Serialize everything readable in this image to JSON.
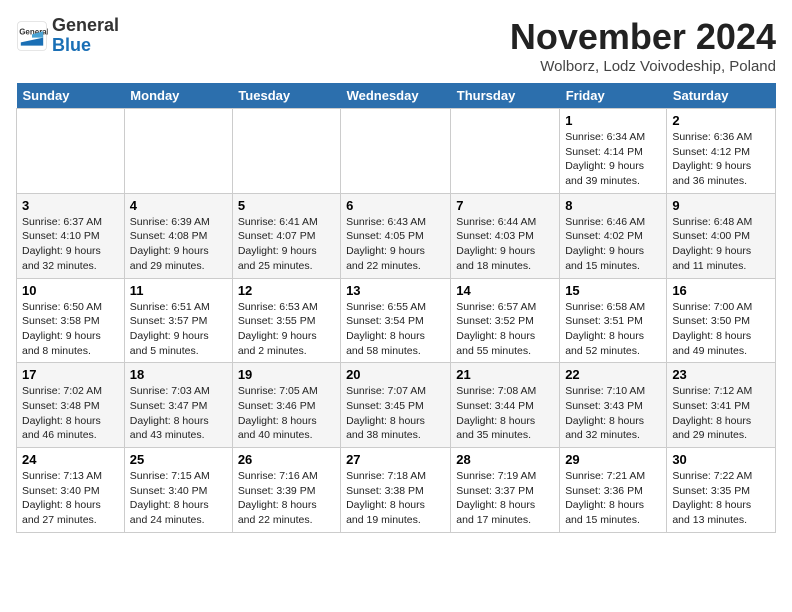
{
  "header": {
    "logo_general": "General",
    "logo_blue": "Blue",
    "month_title": "November 2024",
    "location": "Wolborz, Lodz Voivodeship, Poland"
  },
  "weekdays": [
    "Sunday",
    "Monday",
    "Tuesday",
    "Wednesday",
    "Thursday",
    "Friday",
    "Saturday"
  ],
  "weeks": [
    [
      {
        "day": "",
        "info": ""
      },
      {
        "day": "",
        "info": ""
      },
      {
        "day": "",
        "info": ""
      },
      {
        "day": "",
        "info": ""
      },
      {
        "day": "",
        "info": ""
      },
      {
        "day": "1",
        "info": "Sunrise: 6:34 AM\nSunset: 4:14 PM\nDaylight: 9 hours\nand 39 minutes."
      },
      {
        "day": "2",
        "info": "Sunrise: 6:36 AM\nSunset: 4:12 PM\nDaylight: 9 hours\nand 36 minutes."
      }
    ],
    [
      {
        "day": "3",
        "info": "Sunrise: 6:37 AM\nSunset: 4:10 PM\nDaylight: 9 hours\nand 32 minutes."
      },
      {
        "day": "4",
        "info": "Sunrise: 6:39 AM\nSunset: 4:08 PM\nDaylight: 9 hours\nand 29 minutes."
      },
      {
        "day": "5",
        "info": "Sunrise: 6:41 AM\nSunset: 4:07 PM\nDaylight: 9 hours\nand 25 minutes."
      },
      {
        "day": "6",
        "info": "Sunrise: 6:43 AM\nSunset: 4:05 PM\nDaylight: 9 hours\nand 22 minutes."
      },
      {
        "day": "7",
        "info": "Sunrise: 6:44 AM\nSunset: 4:03 PM\nDaylight: 9 hours\nand 18 minutes."
      },
      {
        "day": "8",
        "info": "Sunrise: 6:46 AM\nSunset: 4:02 PM\nDaylight: 9 hours\nand 15 minutes."
      },
      {
        "day": "9",
        "info": "Sunrise: 6:48 AM\nSunset: 4:00 PM\nDaylight: 9 hours\nand 11 minutes."
      }
    ],
    [
      {
        "day": "10",
        "info": "Sunrise: 6:50 AM\nSunset: 3:58 PM\nDaylight: 9 hours\nand 8 minutes."
      },
      {
        "day": "11",
        "info": "Sunrise: 6:51 AM\nSunset: 3:57 PM\nDaylight: 9 hours\nand 5 minutes."
      },
      {
        "day": "12",
        "info": "Sunrise: 6:53 AM\nSunset: 3:55 PM\nDaylight: 9 hours\nand 2 minutes."
      },
      {
        "day": "13",
        "info": "Sunrise: 6:55 AM\nSunset: 3:54 PM\nDaylight: 8 hours\nand 58 minutes."
      },
      {
        "day": "14",
        "info": "Sunrise: 6:57 AM\nSunset: 3:52 PM\nDaylight: 8 hours\nand 55 minutes."
      },
      {
        "day": "15",
        "info": "Sunrise: 6:58 AM\nSunset: 3:51 PM\nDaylight: 8 hours\nand 52 minutes."
      },
      {
        "day": "16",
        "info": "Sunrise: 7:00 AM\nSunset: 3:50 PM\nDaylight: 8 hours\nand 49 minutes."
      }
    ],
    [
      {
        "day": "17",
        "info": "Sunrise: 7:02 AM\nSunset: 3:48 PM\nDaylight: 8 hours\nand 46 minutes."
      },
      {
        "day": "18",
        "info": "Sunrise: 7:03 AM\nSunset: 3:47 PM\nDaylight: 8 hours\nand 43 minutes."
      },
      {
        "day": "19",
        "info": "Sunrise: 7:05 AM\nSunset: 3:46 PM\nDaylight: 8 hours\nand 40 minutes."
      },
      {
        "day": "20",
        "info": "Sunrise: 7:07 AM\nSunset: 3:45 PM\nDaylight: 8 hours\nand 38 minutes."
      },
      {
        "day": "21",
        "info": "Sunrise: 7:08 AM\nSunset: 3:44 PM\nDaylight: 8 hours\nand 35 minutes."
      },
      {
        "day": "22",
        "info": "Sunrise: 7:10 AM\nSunset: 3:43 PM\nDaylight: 8 hours\nand 32 minutes."
      },
      {
        "day": "23",
        "info": "Sunrise: 7:12 AM\nSunset: 3:41 PM\nDaylight: 8 hours\nand 29 minutes."
      }
    ],
    [
      {
        "day": "24",
        "info": "Sunrise: 7:13 AM\nSunset: 3:40 PM\nDaylight: 8 hours\nand 27 minutes."
      },
      {
        "day": "25",
        "info": "Sunrise: 7:15 AM\nSunset: 3:40 PM\nDaylight: 8 hours\nand 24 minutes."
      },
      {
        "day": "26",
        "info": "Sunrise: 7:16 AM\nSunset: 3:39 PM\nDaylight: 8 hours\nand 22 minutes."
      },
      {
        "day": "27",
        "info": "Sunrise: 7:18 AM\nSunset: 3:38 PM\nDaylight: 8 hours\nand 19 minutes."
      },
      {
        "day": "28",
        "info": "Sunrise: 7:19 AM\nSunset: 3:37 PM\nDaylight: 8 hours\nand 17 minutes."
      },
      {
        "day": "29",
        "info": "Sunrise: 7:21 AM\nSunset: 3:36 PM\nDaylight: 8 hours\nand 15 minutes."
      },
      {
        "day": "30",
        "info": "Sunrise: 7:22 AM\nSunset: 3:35 PM\nDaylight: 8 hours\nand 13 minutes."
      }
    ]
  ]
}
